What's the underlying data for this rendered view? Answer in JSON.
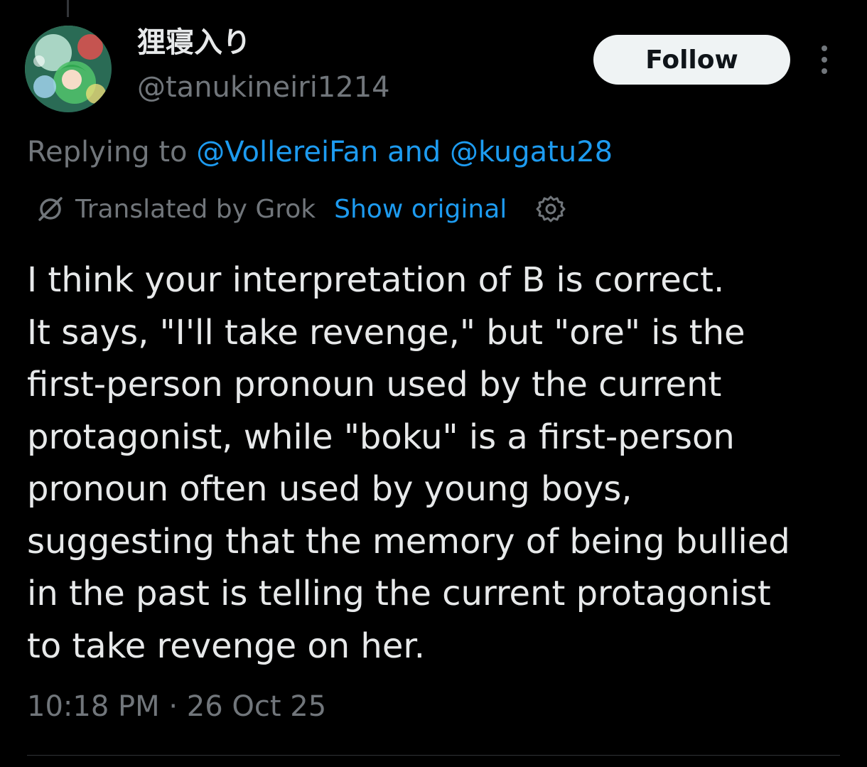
{
  "author": {
    "display_name": "狸寝入り",
    "handle": "@tanukineiri1214"
  },
  "actions": {
    "follow_label": "Follow"
  },
  "reply_context": {
    "prefix": "Replying to ",
    "mention_1": "@VollereiFan",
    "joiner": " and ",
    "mention_2": "@kugatu28"
  },
  "translation": {
    "label": "Translated by Grok",
    "show_original_label": "Show original"
  },
  "tweet": {
    "text": "I think your interpretation of B is correct.\nIt says, \"I'll take revenge,\" but \"ore\" is the\nfirst-person pronoun used by the current\nprotagonist, while \"boku\" is a first-person\npronoun often used by young boys,\nsuggesting that the memory of being bullied\nin the past is telling the current protagonist\nto take revenge on her.",
    "timestamp": "10:18 PM · 26 Oct 25"
  },
  "icons": {
    "translate": "translate-slash-icon",
    "settings": "gear-icon",
    "more": "more-vertical-icon"
  },
  "colors": {
    "background": "#000000",
    "text_primary": "#e7e9ea",
    "text_secondary": "#71767b",
    "link": "#1d9bf0",
    "follow_bg": "#eff3f4"
  }
}
